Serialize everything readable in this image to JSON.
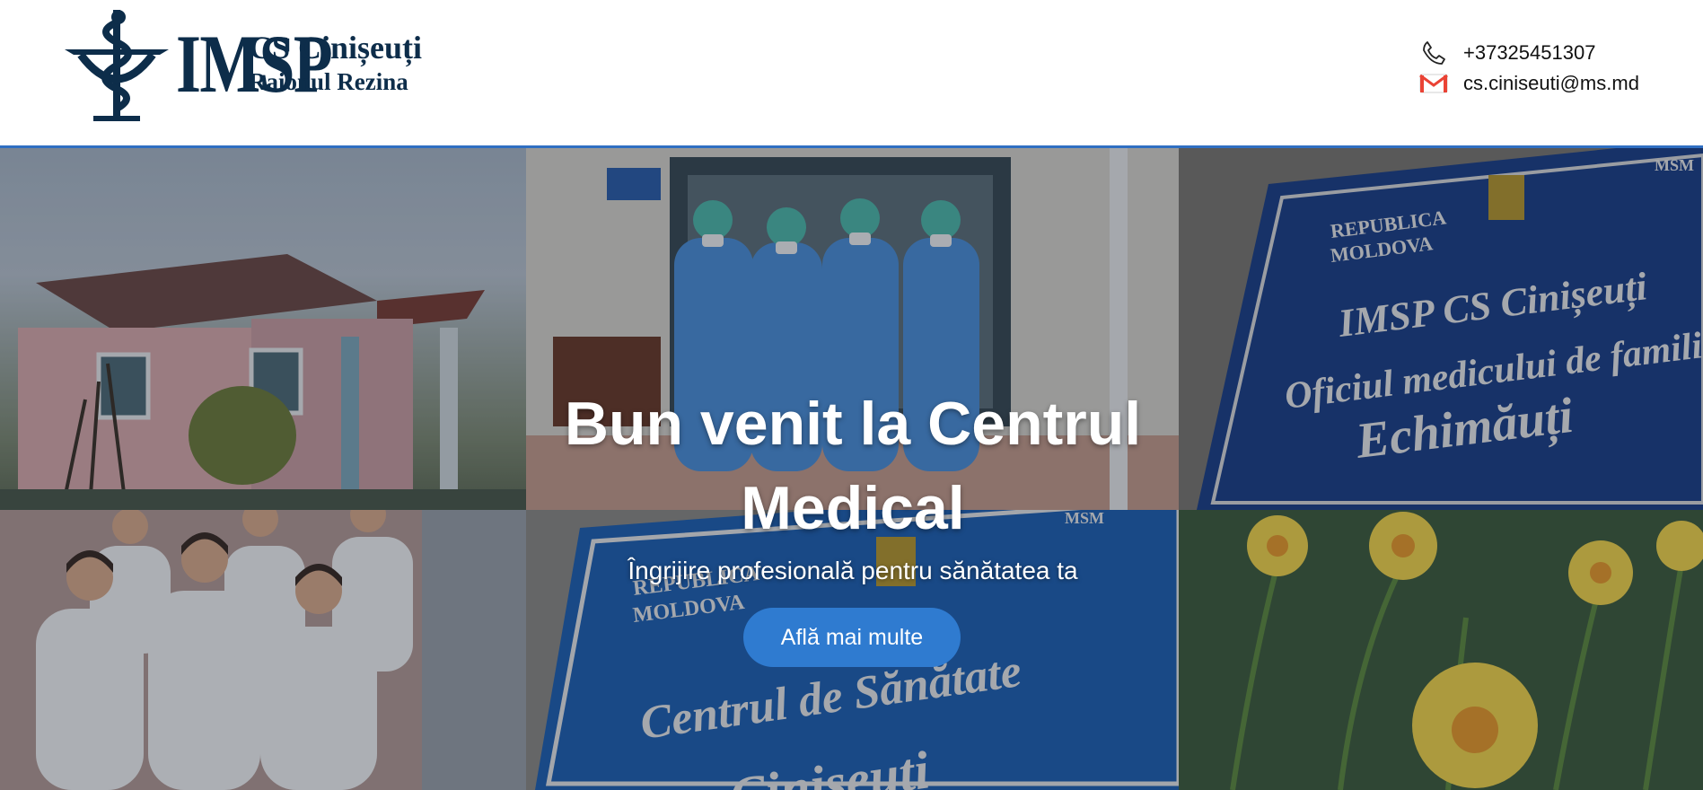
{
  "header": {
    "logo_abbr": "IMSP",
    "logo_name": "CS Cinișeuți",
    "logo_region": "Raionul Rezina",
    "phone": "+37325451307",
    "email": "cs.ciniseuti@ms.md",
    "phone_icon": "phone-icon",
    "email_icon": "gmail-icon"
  },
  "hero": {
    "title": "Bun venit la Centrul Medical",
    "subtitle": "Îngrijire profesională pentru sănătatea ta",
    "cta_label": "Află mai multe",
    "photos": [
      {
        "name": "clinic-building-photo"
      },
      {
        "name": "medical-staff-ppe-photo"
      },
      {
        "name": "echimauti-sign-photo",
        "sign_text": [
          "REPUBLICA",
          "MOLDOVA",
          "IMSP CS Cinișeuți",
          "Oficiul medicului de familie",
          "Echimăuți"
        ],
        "corner": "MSM"
      },
      {
        "name": "doctors-team-photo"
      },
      {
        "name": "health-center-sign-photo",
        "sign_text": [
          "REPUBLICA",
          "MOLDOVA",
          "Centrul de Sănătate",
          "Cinișeuți"
        ],
        "corner": "MSM"
      },
      {
        "name": "daffodils-photo"
      }
    ]
  },
  "colors": {
    "brand_navy": "#0d2d4a",
    "accent_blue": "#2f7bd0",
    "header_border": "#2f6fc2"
  }
}
